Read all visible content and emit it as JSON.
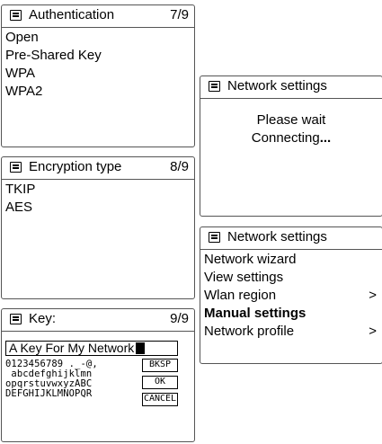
{
  "authentication": {
    "title": "Authentication",
    "count": "7/9",
    "items": [
      "Open",
      "Pre-Shared Key",
      "WPA",
      "WPA2"
    ]
  },
  "encryption": {
    "title": "Encryption type",
    "count": "8/9",
    "items": [
      "TKIP",
      "AES"
    ]
  },
  "key": {
    "title": "Key:",
    "count": "9/9",
    "value": "A Key For My Network",
    "char_rows": [
      "0123456789 ._-@,",
      " abcdefghijklmn",
      "opqrstuvwxyzABC",
      "DEFGHIJKLMNOPQR"
    ],
    "buttons": {
      "bksp": "BKSP",
      "ok": "OK",
      "cancel": "CANCEL"
    }
  },
  "connecting": {
    "title": "Network settings",
    "line1": "Please wait",
    "line2": "Connecting",
    "dots": "..."
  },
  "network_menu": {
    "title": "Network settings",
    "items": [
      {
        "label": "Network wizard",
        "arrow": ""
      },
      {
        "label": "View settings",
        "arrow": ""
      },
      {
        "label": "Wlan region",
        "arrow": ">"
      },
      {
        "label": "Manual settings",
        "arrow": ""
      },
      {
        "label": "Network profile",
        "arrow": ">"
      }
    ],
    "selected_index": 3
  },
  "icons": {
    "menu": "menu-icon"
  }
}
